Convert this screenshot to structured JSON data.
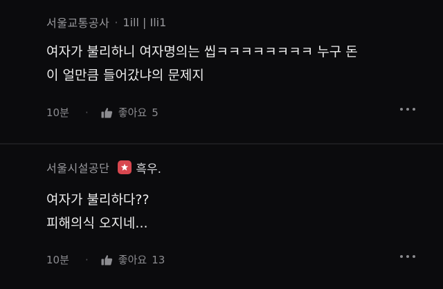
{
  "comments": [
    {
      "company": "서울교통공사",
      "separator": "·",
      "nickname": "1ill | Ili1",
      "text_lines": [
        "여자가 불리하니 여자명의는 씹ㅋㅋㅋㅋㅋㅋㅋㅋ 누구 돈",
        "이 얼만큼 들어갔냐의 문제지"
      ],
      "time": "10분",
      "meta_separator": "·",
      "like_label": "좋아요",
      "like_count": "5"
    },
    {
      "company": "서울시설공단",
      "badge_color": "#d8474f",
      "nickname": "흑우.",
      "text_lines": [
        "여자가 불리하다??",
        "피해의식 오지네..."
      ],
      "time": "10분",
      "meta_separator": "·",
      "like_label": "좋아요",
      "like_count": "13"
    }
  ],
  "icons": {
    "like": "thumbs-up-icon",
    "more": "more-dots-icon",
    "badge": "shield-star-icon"
  }
}
